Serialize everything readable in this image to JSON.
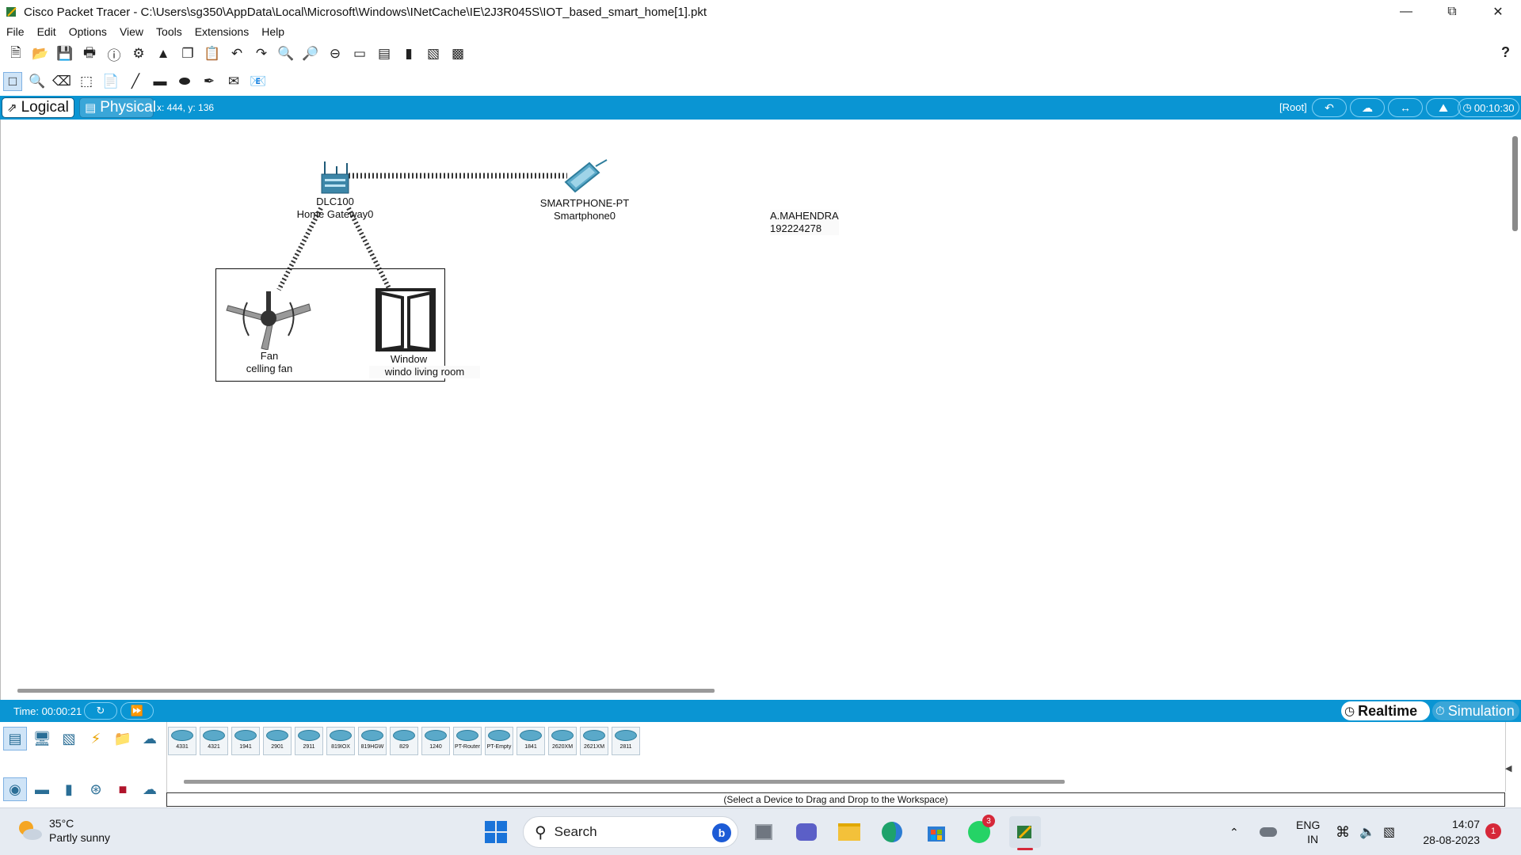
{
  "window": {
    "title": "Cisco Packet Tracer - C:\\Users\\sg350\\AppData\\Local\\Microsoft\\Windows\\INetCache\\IE\\2J3R045S\\IOT_based_smart_home[1].pkt"
  },
  "menu": [
    "File",
    "Edit",
    "Options",
    "View",
    "Tools",
    "Extensions",
    "Help"
  ],
  "modebar": {
    "logical": "Logical",
    "physical": "Physical",
    "coords": "x: 444, y: 136",
    "root": "[Root]",
    "clock": "00:10:30"
  },
  "workspace": {
    "gateway": {
      "model": "DLC100",
      "name": "Home Gateway0"
    },
    "smartphone": {
      "model": "SMARTPHONE-PT",
      "name": "Smartphone0"
    },
    "note": {
      "line1": "A.MAHENDRA",
      "line2": "192224278"
    },
    "fan": {
      "type": "Fan",
      "name": "celling fan"
    },
    "window": {
      "type": "Window",
      "name": "windo living room"
    }
  },
  "timebar": {
    "time": "Time: 00:00:21",
    "realtime": "Realtime",
    "simulation": "Simulation"
  },
  "palette": {
    "models": [
      "4331",
      "4321",
      "1941",
      "2901",
      "2911",
      "819IOX",
      "819HGW",
      "829",
      "1240",
      "PT-Router",
      "PT-Empty",
      "1841",
      "2620XM",
      "2621XM",
      "2811"
    ],
    "status": "(Select a Device to Drag and Drop to the Workspace)"
  },
  "taskbar": {
    "temperature": "35°C",
    "condition": "Partly sunny",
    "search": "Search",
    "lang1": "ENG",
    "lang2": "IN",
    "time": "14:07",
    "date": "28-08-2023",
    "whatsapp_badge": "3",
    "notifications": "1"
  },
  "colors": {
    "accent_bar": "#0a95d3",
    "link_dashes": "#333333",
    "taskbar_bg": "#e6ebf2"
  }
}
